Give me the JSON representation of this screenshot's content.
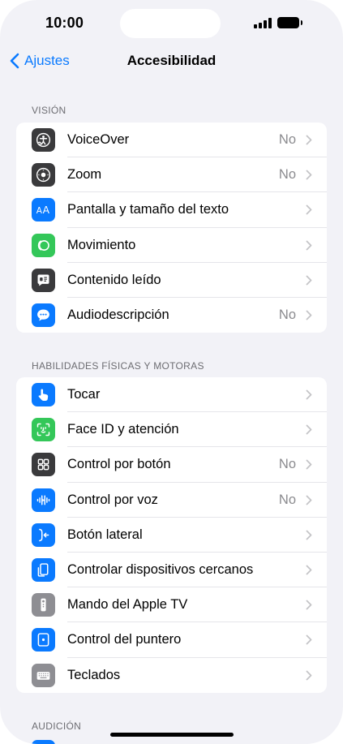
{
  "status_bar": {
    "time": "10:00"
  },
  "nav": {
    "back_label": "Ajustes",
    "title": "Accesibilidad"
  },
  "colors": {
    "accent": "#0a7aff",
    "background": "#f2f2f7",
    "secondary_text": "#8a8a8e"
  },
  "sections": [
    {
      "header": "VISIÓN",
      "items": [
        {
          "label": "VoiceOver",
          "value": "No",
          "icon": "voiceover-icon",
          "icon_bg": "#3a3a3c"
        },
        {
          "label": "Zoom",
          "value": "No",
          "icon": "zoom-icon",
          "icon_bg": "#3a3a3c"
        },
        {
          "label": "Pantalla y tamaño del texto",
          "value": "",
          "icon": "text-size-icon",
          "icon_bg": "#0a7aff"
        },
        {
          "label": "Movimiento",
          "value": "",
          "icon": "motion-icon",
          "icon_bg": "#34c759"
        },
        {
          "label": "Contenido leído",
          "value": "",
          "icon": "spoken-content-icon",
          "icon_bg": "#3a3a3c"
        },
        {
          "label": "Audiodescripción",
          "value": "No",
          "icon": "audio-description-icon",
          "icon_bg": "#0a7aff"
        }
      ]
    },
    {
      "header": "HABILIDADES FÍSICAS Y MOTORAS",
      "items": [
        {
          "label": "Tocar",
          "value": "",
          "icon": "touch-icon",
          "icon_bg": "#0a7aff"
        },
        {
          "label": "Face ID y atención",
          "value": "",
          "icon": "face-id-icon",
          "icon_bg": "#34c759"
        },
        {
          "label": "Control por botón",
          "value": "No",
          "icon": "switch-control-icon",
          "icon_bg": "#3a3a3c"
        },
        {
          "label": "Control por voz",
          "value": "No",
          "icon": "voice-control-icon",
          "icon_bg": "#0a7aff"
        },
        {
          "label": "Botón lateral",
          "value": "",
          "icon": "side-button-icon",
          "icon_bg": "#0a7aff"
        },
        {
          "label": "Controlar dispositivos cercanos",
          "value": "",
          "icon": "nearby-devices-icon",
          "icon_bg": "#0a7aff"
        },
        {
          "label": "Mando del Apple TV",
          "value": "",
          "icon": "apple-tv-remote-icon",
          "icon_bg": "#8e8e93"
        },
        {
          "label": "Control del puntero",
          "value": "",
          "icon": "pointer-control-icon",
          "icon_bg": "#0a7aff"
        },
        {
          "label": "Teclados",
          "value": "",
          "icon": "keyboard-icon",
          "icon_bg": "#8e8e93"
        }
      ]
    },
    {
      "header": "AUDICIÓN",
      "items": []
    }
  ]
}
